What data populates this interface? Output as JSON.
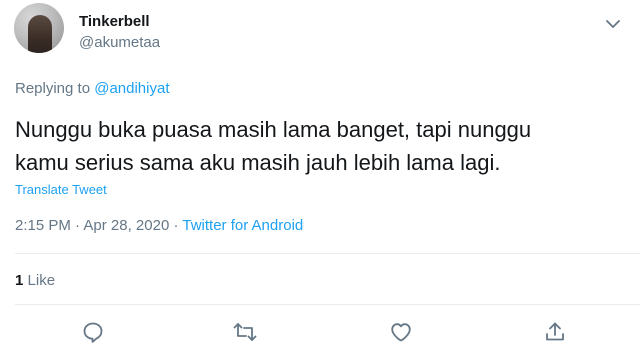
{
  "user": {
    "display_name": "Tinkerbell",
    "handle": "@akumetaa",
    "avatar_icon": "profile-photo"
  },
  "menu_icon": "chevron-down-icon",
  "reply": {
    "prefix": "Replying to",
    "target": "@andihiyat"
  },
  "tweet": {
    "line1": "Nunggu buka puasa masih lama banget, tapi nunggu",
    "line2": "kamu serius sama aku masih jauh lebih lama lagi.",
    "translate_label": "Translate Tweet"
  },
  "meta": {
    "time": "2:15 PM",
    "sep1": " · ",
    "date": "Apr 28, 2020",
    "sep2": " · ",
    "source": "Twitter for Android"
  },
  "stats": {
    "like_count": "1",
    "like_label": "Like"
  },
  "actions": [
    "reply-icon",
    "retweet-icon",
    "like-icon",
    "share-icon"
  ],
  "colors": {
    "text": "#14171a",
    "secondary": "#657786",
    "link": "#1da1f2",
    "divider": "#e6ecf0"
  }
}
